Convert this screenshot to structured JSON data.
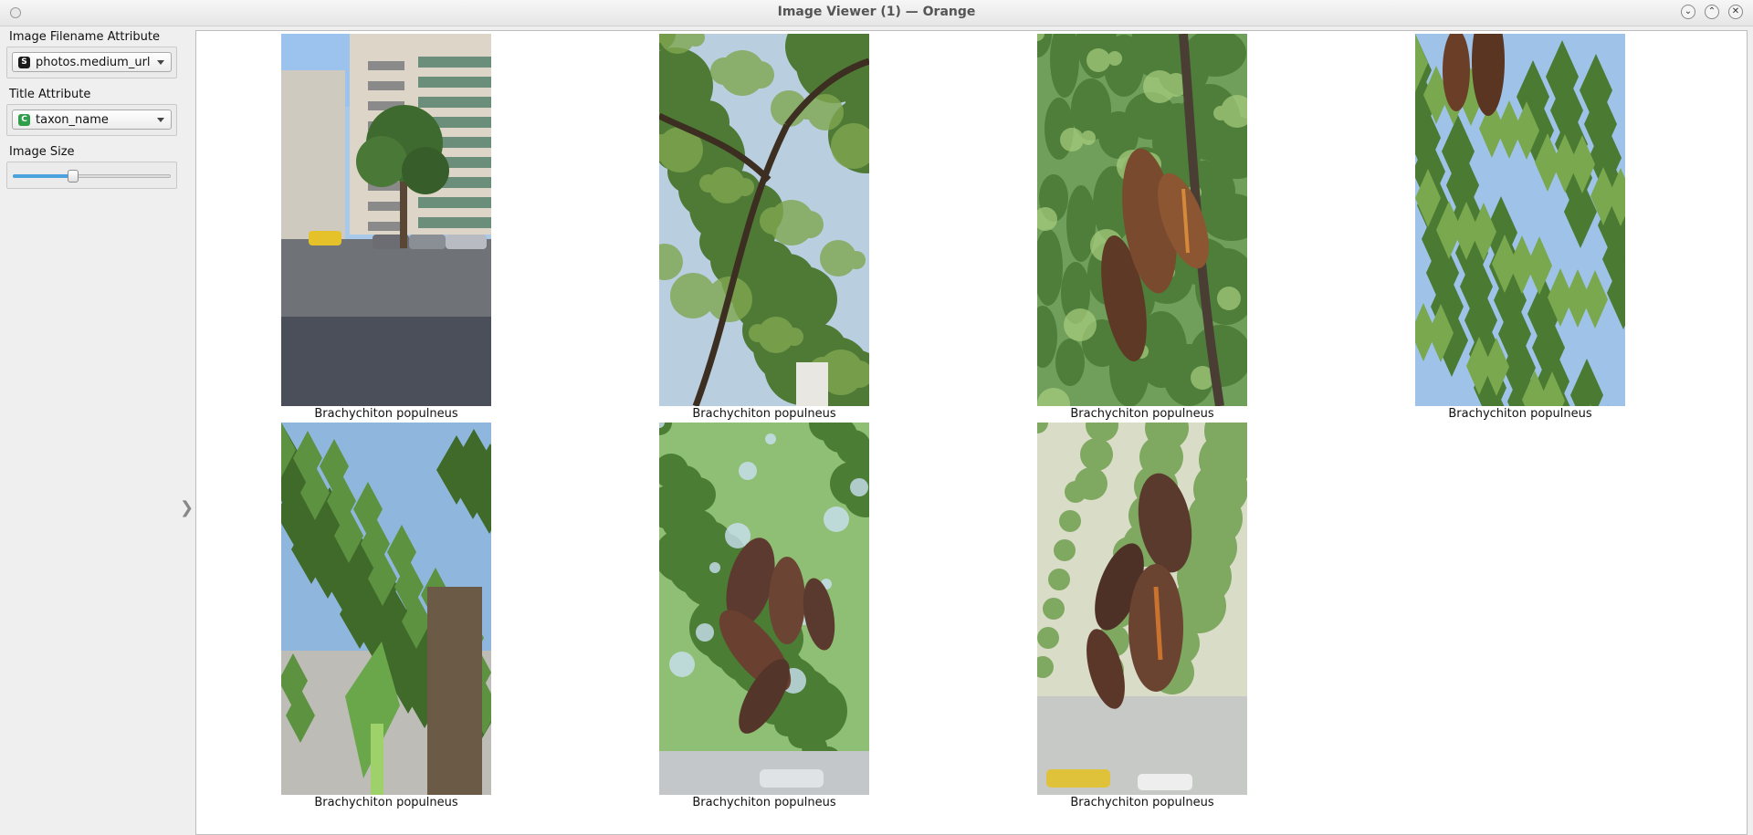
{
  "window": {
    "title": "Image Viewer (1) — Orange"
  },
  "controls": {
    "filename_label": "Image Filename Attribute",
    "filename_value": "photos.medium_url",
    "filename_type_icon": "S",
    "title_label": "Title Attribute",
    "title_value": "taxon_name",
    "title_type_icon": "C",
    "size_label": "Image Size",
    "size_fraction": 0.38
  },
  "colors": {
    "accent": "#4aa3df",
    "string_var": "#1a1a1a",
    "categorical_var": "#2e9e4a"
  },
  "images": [
    {
      "caption": "Brachychiton populneus",
      "scene": "street"
    },
    {
      "caption": "Brachychiton populneus",
      "scene": "canopy"
    },
    {
      "caption": "Brachychiton populneus",
      "scene": "pods"
    },
    {
      "caption": "Brachychiton populneus",
      "scene": "leaves"
    },
    {
      "caption": "Brachychiton populneus",
      "scene": "trunk"
    },
    {
      "caption": "Brachychiton populneus",
      "scene": "pods-cluster"
    },
    {
      "caption": "Brachychiton populneus",
      "scene": "pods-open"
    }
  ]
}
